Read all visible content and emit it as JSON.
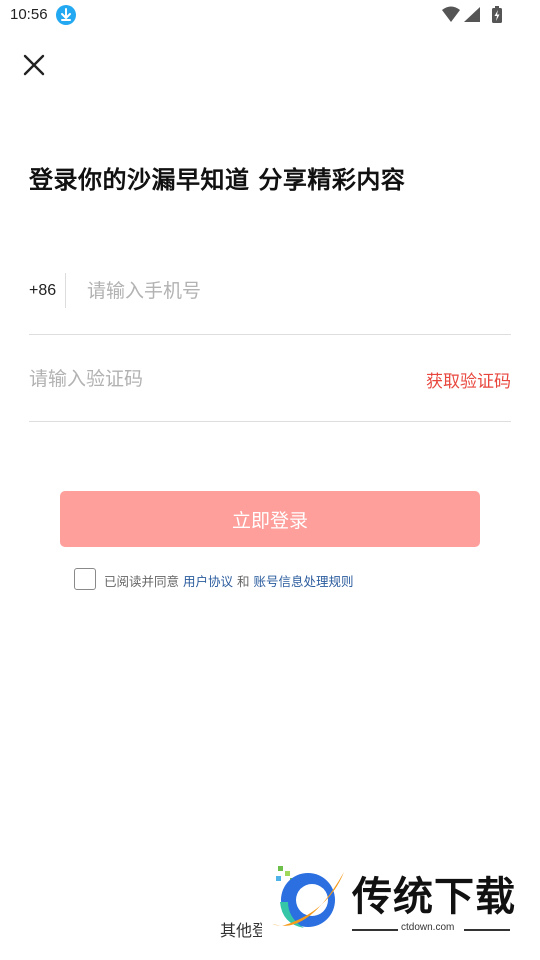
{
  "status_bar": {
    "time": "10:56",
    "download_icon": "download-arrow-icon",
    "wifi_icon": "wifi-icon",
    "signal_icon": "cell-signal-icon",
    "battery_icon": "battery-charging-icon"
  },
  "header": {
    "close_icon": "close-x-icon"
  },
  "title": "登录你的沙漏早知道 分享精彩内容",
  "phone": {
    "country_code": "+86",
    "placeholder": "请输入手机号",
    "value": ""
  },
  "verification": {
    "placeholder": "请输入验证码",
    "value": "",
    "get_code_label": "获取验证码"
  },
  "login_button_label": "立即登录",
  "agreement": {
    "checked": false,
    "prefix": "已阅读并同意 ",
    "user_agreement": "用户协议",
    "connector": " 和 ",
    "privacy_rules": "账号信息处理规则"
  },
  "other_login_label": "其他登",
  "watermark": {
    "brand": "传统下载",
    "site": "ctdown.com"
  },
  "colors": {
    "accent_red": "#e8473e",
    "button_disabled": "#ff9f9b",
    "link_blue": "#2b5c9e",
    "divider": "#dedede",
    "placeholder": "#b2b2b2"
  }
}
